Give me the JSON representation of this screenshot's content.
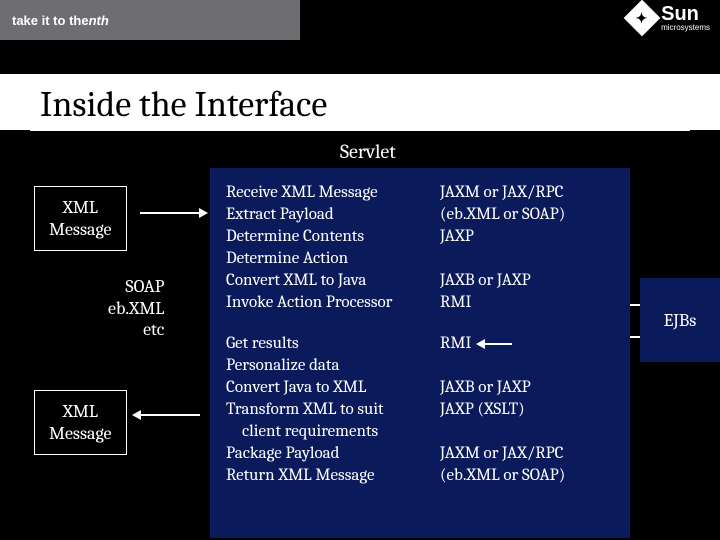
{
  "header": {
    "tagline_prefix": "take it to the ",
    "tagline_suffix": "nth",
    "brand_name": "Sun",
    "brand_sub": "microsystems"
  },
  "title": "Inside the Interface",
  "servlet_label": "Servlet",
  "xml_box": {
    "line1": "XML",
    "line2": "Message"
  },
  "protocols": {
    "p1": "SOAP",
    "p2": "eb.XML",
    "p3": "etc"
  },
  "main": {
    "block1": [
      {
        "left": "Receive XML Message",
        "right": "JAXM or JAX/RPC"
      },
      {
        "left": "Extract Payload",
        "right": "(eb.XML or SOAP)"
      },
      {
        "left": "Determine Contents",
        "right": "JAXP"
      },
      {
        "left": "Determine Action",
        "right": ""
      },
      {
        "left": "Convert XML to Java",
        "right": "JAXB or JAXP"
      },
      {
        "left": "Invoke Action Processor",
        "right": "RMI"
      }
    ],
    "block2": [
      {
        "left": "Get results",
        "right": "RMI"
      },
      {
        "left": "Personalize data",
        "right": ""
      },
      {
        "left": "Convert Java to XML",
        "right": "JAXB or JAXP"
      },
      {
        "left": "Transform XML to suit",
        "right": "JAXP (XSLT)"
      },
      {
        "left": "client requirements",
        "right": "",
        "indent": true
      },
      {
        "left": "Package Payload",
        "right": "JAXM or JAX/RPC"
      },
      {
        "left": "Return XML Message",
        "right": "(eb.XML or SOAP)"
      }
    ]
  },
  "ejb_label": "EJBs"
}
